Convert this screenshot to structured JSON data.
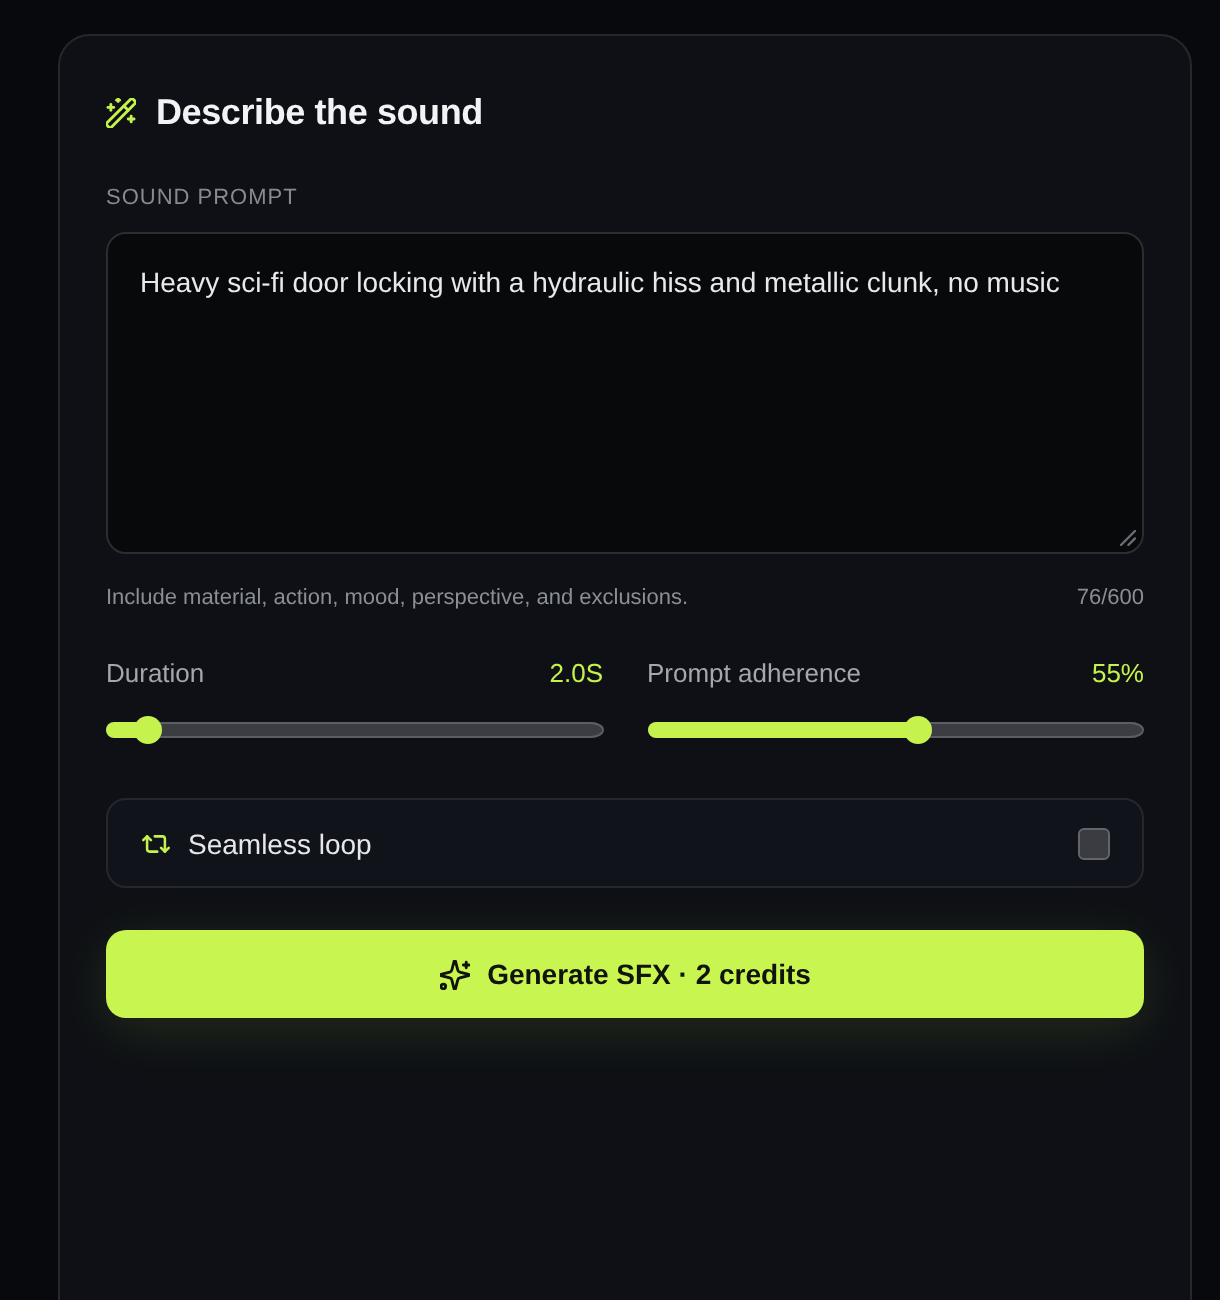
{
  "panel": {
    "title": "Describe the sound"
  },
  "prompt": {
    "label": "SOUND PROMPT",
    "value": "Heavy sci-fi door locking with a hydraulic hiss and metallic clunk, no music",
    "hint": "Include material, action, mood, perspective, and exclusions.",
    "counter": "76/600"
  },
  "sliders": [
    {
      "label": "Duration",
      "reading": "2.0S",
      "level": 0.06
    },
    {
      "label": "Prompt adherence",
      "reading": "55%",
      "level": 0.55
    }
  ],
  "loop": {
    "label": "Seamless loop",
    "checked": false
  },
  "generate_button": {
    "label": "Generate SFX · 2 credits"
  }
}
